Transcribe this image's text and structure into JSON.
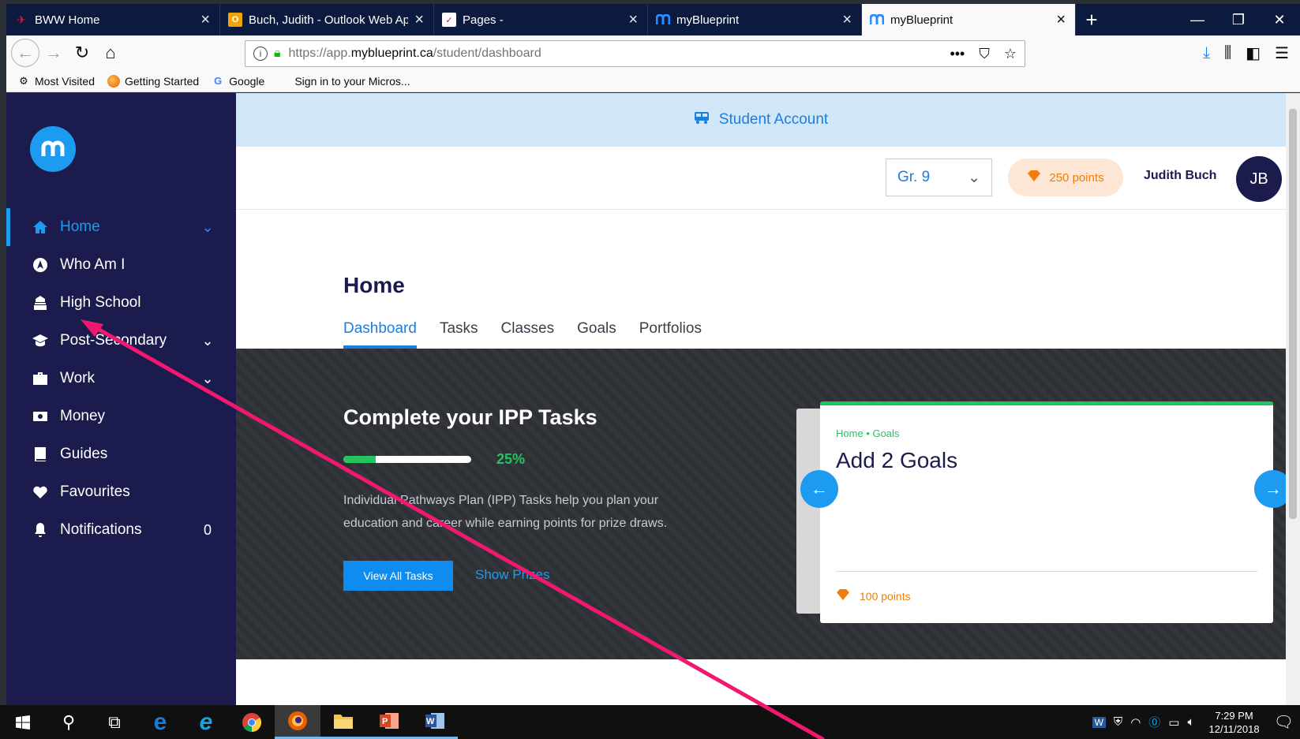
{
  "browser": {
    "tabs": [
      {
        "title": "BWW Home",
        "icon": "bww-logo-icon",
        "active": false
      },
      {
        "title": "Buch, Judith - Outlook Web Ap",
        "icon": "outlook-icon",
        "active": false
      },
      {
        "title": "Pages -",
        "icon": "pages-icon",
        "active": false
      },
      {
        "title": "myBlueprint",
        "icon": "myblueprint-icon",
        "active": false
      },
      {
        "title": "myBlueprint",
        "icon": "myblueprint-icon",
        "active": true
      }
    ],
    "url_prefix": "https://app.",
    "url_domain": "myblueprint.ca",
    "url_path": "/student/dashboard",
    "bookmarks": [
      {
        "label": "Most Visited",
        "icon": "gear-icon"
      },
      {
        "label": "Getting Started",
        "icon": "firefox-icon"
      },
      {
        "label": "Google",
        "icon": "google-icon"
      },
      {
        "label": "Sign in to your Micros...",
        "icon": "microsoft-icon"
      }
    ]
  },
  "sidebar": {
    "items": [
      {
        "label": "Home",
        "icon": "home-icon",
        "right": "chevron-down",
        "active": true
      },
      {
        "label": "Who Am I",
        "icon": "compass-icon",
        "right": "",
        "active": false
      },
      {
        "label": "High School",
        "icon": "school-icon",
        "right": "",
        "active": false
      },
      {
        "label": "Post-Secondary",
        "icon": "graduation-cap-icon",
        "right": "chevron-down",
        "active": false
      },
      {
        "label": "Work",
        "icon": "briefcase-icon",
        "right": "chevron-down",
        "active": false
      },
      {
        "label": "Money",
        "icon": "money-icon",
        "right": "",
        "active": false
      },
      {
        "label": "Guides",
        "icon": "book-icon",
        "right": "",
        "active": false
      },
      {
        "label": "Favourites",
        "icon": "heart-icon",
        "right": "",
        "active": false
      },
      {
        "label": "Notifications",
        "icon": "bell-icon",
        "right": "0",
        "active": false
      }
    ]
  },
  "banner": {
    "label": "Student Account",
    "icon": "bus-icon"
  },
  "header": {
    "grade": "Gr. 9",
    "points": "250 points",
    "user_name": "Judith Buch",
    "avatar_initials": "JB"
  },
  "page": {
    "title": "Home",
    "tabs": [
      "Dashboard",
      "Tasks",
      "Classes",
      "Goals",
      "Portfolios"
    ],
    "active_tab": "Dashboard"
  },
  "hero": {
    "title": "Complete your IPP Tasks",
    "progress_percent": 25,
    "progress_label": "25%",
    "description": "Individual Pathways Plan (IPP) Tasks help you plan your education and career while earning points for prize draws.",
    "primary_button": "View All Tasks",
    "secondary_link": "Show Prizes"
  },
  "task_card": {
    "breadcrumb": "Home • Goals",
    "title": "Add 2 Goals",
    "points": "100 points"
  },
  "taskbar": {
    "time": "7:29 PM",
    "date": "12/11/2018"
  },
  "colors": {
    "sidebar_bg": "#1c1b4d",
    "accent_blue": "#1d9bf0",
    "success_green": "#22c55e",
    "points_orange": "#ef7d0b",
    "annotation_arrow": "#f0186f"
  }
}
